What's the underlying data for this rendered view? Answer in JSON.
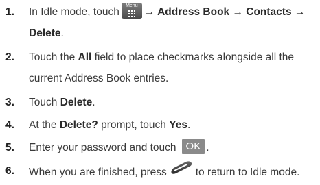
{
  "steps": [
    {
      "number": "1.",
      "line1_text": "In Idle mode, touch",
      "menu_icon_label": "Menu",
      "line1_tail": "→ Address Book → Contacts →",
      "line2_bold": "Delete",
      "line2_tail": "."
    },
    {
      "number": "2.",
      "line1_pre": "Touch the",
      "line1_bold": "All",
      "line1_post": "field to place checkmarks alongside all the",
      "line2": "current Address Book entries."
    },
    {
      "number": "3.",
      "pre": "Touch",
      "bold": "Delete",
      "post": "."
    },
    {
      "number": "4.",
      "pre": "At the",
      "bold1": "Delete?",
      "mid": "prompt, touch",
      "bold2": "Yes",
      "post": "."
    },
    {
      "number": "5.",
      "pre": "Enter your password and touch",
      "button_label": "OK",
      "post": "."
    },
    {
      "number": "6.",
      "pre": "When you are finished, press",
      "icon": "end-key-icon",
      "post": "to return to Idle mode."
    }
  ]
}
